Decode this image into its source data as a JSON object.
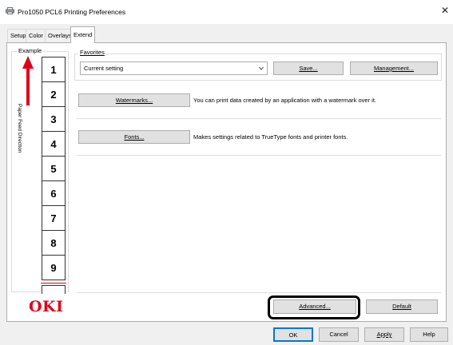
{
  "window": {
    "title": "Pro1050 PCL6 Printing Preferences",
    "close_icon": "close-icon"
  },
  "tabs": [
    {
      "label": "Setup",
      "active": false
    },
    {
      "label": "Color",
      "active": false
    },
    {
      "label": "Overlays",
      "active": false
    },
    {
      "label": "Extend",
      "active": true
    }
  ],
  "example": {
    "label": "Example",
    "feed_direction": "Paper Feed Direction",
    "pages": [
      "1",
      "2",
      "3",
      "4",
      "5",
      "6",
      "7",
      "8",
      "9"
    ],
    "arrow_color": "#e0001a"
  },
  "favorites": {
    "label": "Favorites",
    "selected": "Current setting",
    "save_label": "Save...",
    "management_label": "Management..."
  },
  "watermarks": {
    "button_label": "Watermarks...",
    "description": "You can print data created by an application with a watermark over it."
  },
  "fonts": {
    "button_label": "Fonts...",
    "description": "Makes settings related to TrueType fonts and printer fonts."
  },
  "brand": {
    "logo_text": "OKI",
    "color": "#e0001a"
  },
  "actions": {
    "advanced_label": "Advanced...",
    "default_label": "Default"
  },
  "dialog_buttons": {
    "ok": "OK",
    "cancel": "Cancel",
    "apply": "Apply",
    "help": "Help"
  }
}
